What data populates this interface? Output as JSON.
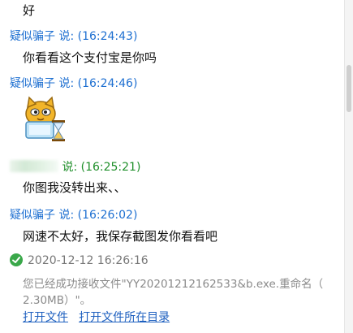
{
  "messages": {
    "m0": {
      "text": "好"
    },
    "m1": {
      "sender": "疑似骗子",
      "said": "说:",
      "time": "(16:24:43)",
      "text": "你看看这个支付宝是你吗"
    },
    "m2": {
      "sender": "疑似骗子",
      "said": "说:",
      "time": "(16:24:46)"
    },
    "m3": {
      "said": "说:",
      "time": "(16:25:21)",
      "text": "你图我没转出来、、"
    },
    "m4": {
      "sender": "疑似骗子",
      "said": "说:",
      "time": "(16:26:02)",
      "text": "网速不太好，我保存截图发你看看吧"
    }
  },
  "file_transfer": {
    "datetime": "2020-12-12 16:26:16",
    "line1": "您已经成功接收文件\"YY20201212162533&b.exe.重命名（",
    "line2": "2.30MB）\"。",
    "open_file": "打开文件",
    "open_folder": "打开文件所在目录"
  },
  "icons": {
    "sticker": "hourglass-cat-sticker-icon",
    "check": "check-circle-icon"
  },
  "colors": {
    "sender": "#1d6fd1",
    "self_sender": "#1f8f2a",
    "link": "#1d5fbf",
    "check": "#3aa84a",
    "system_text": "#8a8a8a"
  }
}
